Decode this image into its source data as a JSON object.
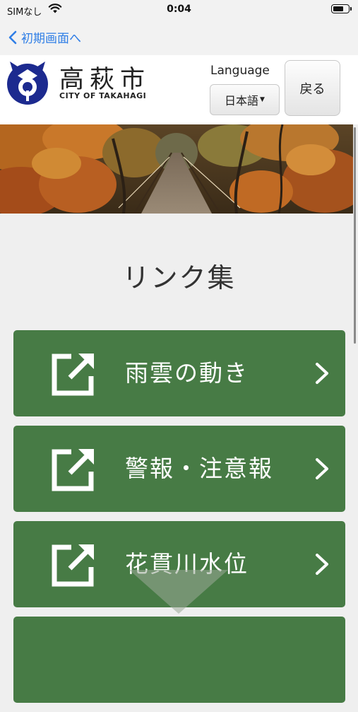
{
  "status_bar": {
    "carrier": "SIMなし",
    "time": "0:04",
    "battery_level": 0.75
  },
  "nav": {
    "back_label": "初期画面へ"
  },
  "header": {
    "city_name_jp": "高萩市",
    "city_name_en": "CITY OF TAKAHAGI",
    "language_label": "Language",
    "language_selected": "日本語",
    "back_button_label": "戻る"
  },
  "page": {
    "title": "リンク集"
  },
  "links": [
    {
      "label": "雨雲の動き",
      "icon": "external-link-icon"
    },
    {
      "label": "警報・注意報",
      "icon": "external-link-icon"
    },
    {
      "label": "花貫川水位",
      "icon": "external-link-icon"
    }
  ],
  "colors": {
    "link_green": "#477b45",
    "ios_blue": "#2f7ee6",
    "seal_navy": "#1c2a8f"
  }
}
